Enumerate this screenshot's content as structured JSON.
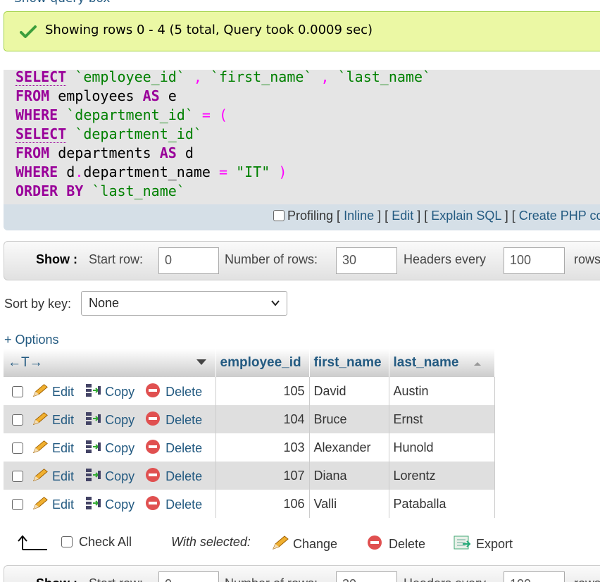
{
  "top_link": "Show query box",
  "success": {
    "message": "Showing rows 0 - 4 (5 total, Query took 0.0009 sec)",
    "check_color": "#3c9e3c"
  },
  "sql": {
    "l1_kw": "SELECT",
    "l1_c1": "`employee_id`",
    "l1_sep1": " , ",
    "l1_c2": "`first_name`",
    "l1_sep2": " , ",
    "l1_c3": "`last_name`",
    "l2_kw": "FROM",
    "l2_t": " employees ",
    "l2_as": "AS",
    "l2_alias": " e",
    "l3_kw": "WHERE",
    "l3_c": "`department_id`",
    "l3_op": " = (",
    "l4_kw": "SELECT",
    "l4_c": "`department_id`",
    "l5_kw": "FROM",
    "l5_t": " departments ",
    "l5_as": "AS",
    "l5_alias": " d",
    "l6_kw": "WHERE",
    "l6_a": " d",
    "l6_dot": ".",
    "l6_b": "department_name",
    "l6_op": " = ",
    "l6_val": "\"IT\"",
    "l6_close": " )",
    "l7_kw": "ORDER BY",
    "l7_c": " `last_name`"
  },
  "sql_toolbar": {
    "profiling": "Profiling",
    "inline": "Inline",
    "edit": "Edit",
    "explain": "Explain SQL",
    "create": "Create PHP code",
    "lb": "[",
    "rb": "]"
  },
  "nav": {
    "show": "Show :",
    "start_row_label": "Start row:",
    "start_row": "0",
    "num_rows_label": "Number of rows:",
    "num_rows": "30",
    "headers_every_label": "Headers every",
    "headers_every": "100",
    "rows_label": "rows"
  },
  "sort": {
    "label": "Sort by key:",
    "value": "None"
  },
  "options_link": "+ Options",
  "table": {
    "arrows": "←T→",
    "columns": [
      "employee_id",
      "first_name",
      "last_name"
    ],
    "edit": "Edit",
    "copy": "Copy",
    "delete": "Delete",
    "rows": [
      [
        "105",
        "David",
        "Austin"
      ],
      [
        "104",
        "Bruce",
        "Ernst"
      ],
      [
        "103",
        "Alexander",
        "Hunold"
      ],
      [
        "107",
        "Diana",
        "Lorentz"
      ],
      [
        "106",
        "Valli",
        "Pataballa"
      ]
    ]
  },
  "bottom": {
    "check_all": "Check All",
    "with_selected": "With selected:",
    "change": "Change",
    "delete": "Delete",
    "export": "Export"
  }
}
